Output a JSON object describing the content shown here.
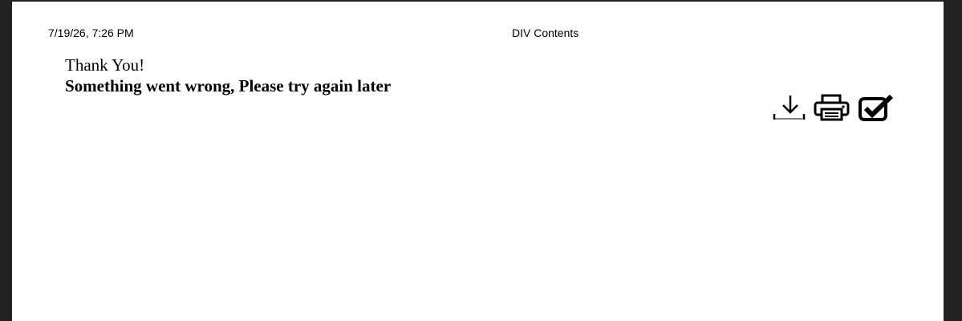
{
  "page_header": {
    "date_time": "7/19/26, 7:26 PM",
    "title": "DIV Contents"
  },
  "message": {
    "line1": "Thank You!",
    "line2": "Something went wrong, Please try again later"
  },
  "icons": {
    "download": "download-icon",
    "print": "print-icon",
    "check": "checkbox-checked-icon"
  },
  "colors": {
    "viewer_background": "#222222",
    "page_background": "#ffffff",
    "text": "#000000"
  }
}
